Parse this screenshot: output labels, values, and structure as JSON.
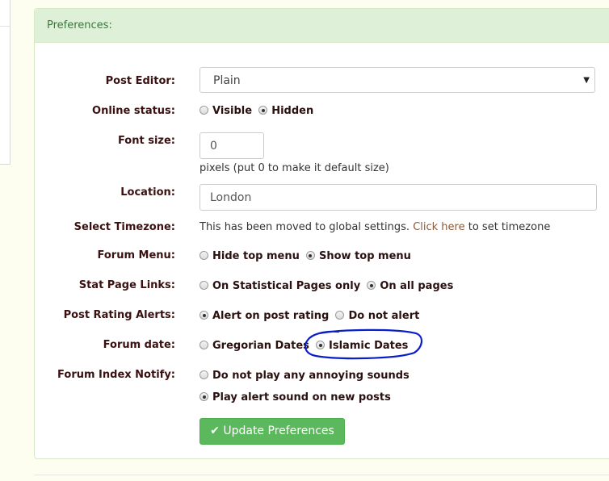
{
  "panel": {
    "heading": "Preferences:"
  },
  "post_editor": {
    "label": "Post Editor:",
    "selected": "Plain"
  },
  "online_status": {
    "label": "Online status:",
    "options": [
      "Visible",
      "Hidden"
    ],
    "selected": "Hidden"
  },
  "font_size": {
    "label": "Font size:",
    "value": "0",
    "help": "pixels (put 0 to make it default size)"
  },
  "location": {
    "label": "Location:",
    "value": "London"
  },
  "timezone": {
    "label": "Select Timezone:",
    "text_before": "This has been moved to global settings.",
    "link": "Click here",
    "text_after": "to set timezone"
  },
  "forum_menu": {
    "label": "Forum Menu:",
    "options": [
      "Hide top menu",
      "Show top menu"
    ],
    "selected": "Show top menu"
  },
  "stat_page_links": {
    "label": "Stat Page Links:",
    "options": [
      "On Statistical Pages only",
      "On all pages"
    ],
    "selected": "On all pages"
  },
  "post_rating_alerts": {
    "label": "Post Rating Alerts:",
    "options": [
      "Alert on post rating",
      "Do not alert"
    ],
    "selected": "Alert on post rating"
  },
  "forum_date": {
    "label": "Forum date:",
    "options": [
      "Gregorian Dates",
      "Islamic Dates"
    ],
    "selected": "Islamic Dates"
  },
  "forum_index_notify": {
    "label": "Forum Index Notify:",
    "options": [
      "Do not play any annoying sounds",
      "Play alert sound on new posts"
    ],
    "selected": "Play alert sound on new posts"
  },
  "submit": {
    "label": "Update Preferences"
  },
  "colors": {
    "panel_heading_bg": "#dff0d8",
    "button_bg": "#5cb85c",
    "annotation": "#0a1ec8"
  }
}
